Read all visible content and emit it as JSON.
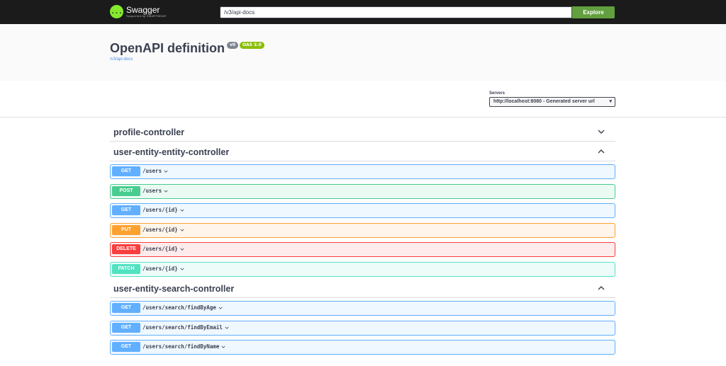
{
  "topbar": {
    "logo_name": "Swagger",
    "logo_sub": "Supported by SMARTBEAR",
    "logo_glyph": "{...}",
    "url_value": "/v3/api-docs",
    "explore_label": "Explore"
  },
  "info": {
    "title": "OpenAPI definition",
    "version": "v0",
    "oas": "OAS 3.0",
    "link": "/v3/api-docs"
  },
  "servers": {
    "label": "Servers",
    "selected": "http://localhost:8080 - Generated server url"
  },
  "sections": [
    {
      "name": "profile-controller",
      "expanded": false,
      "operations": []
    },
    {
      "name": "user-entity-entity-controller",
      "expanded": true,
      "operations": [
        {
          "method": "GET",
          "path": "/users"
        },
        {
          "method": "POST",
          "path": "/users"
        },
        {
          "method": "GET",
          "path": "/users/{id}"
        },
        {
          "method": "PUT",
          "path": "/users/{id}"
        },
        {
          "method": "DELETE",
          "path": "/users/{id}"
        },
        {
          "method": "PATCH",
          "path": "/users/{id}"
        }
      ]
    },
    {
      "name": "user-entity-search-controller",
      "expanded": true,
      "operations": [
        {
          "method": "GET",
          "path": "/users/search/findByAge"
        },
        {
          "method": "GET",
          "path": "/users/search/findByEmail"
        },
        {
          "method": "GET",
          "path": "/users/search/findByName"
        }
      ]
    }
  ],
  "colors": {
    "get": "#61affe",
    "post": "#49cc90",
    "put": "#fca130",
    "delete": "#f93e3e",
    "patch": "#50e3c2",
    "topbar": "#1b1b1b",
    "explore": "#62a03f"
  }
}
